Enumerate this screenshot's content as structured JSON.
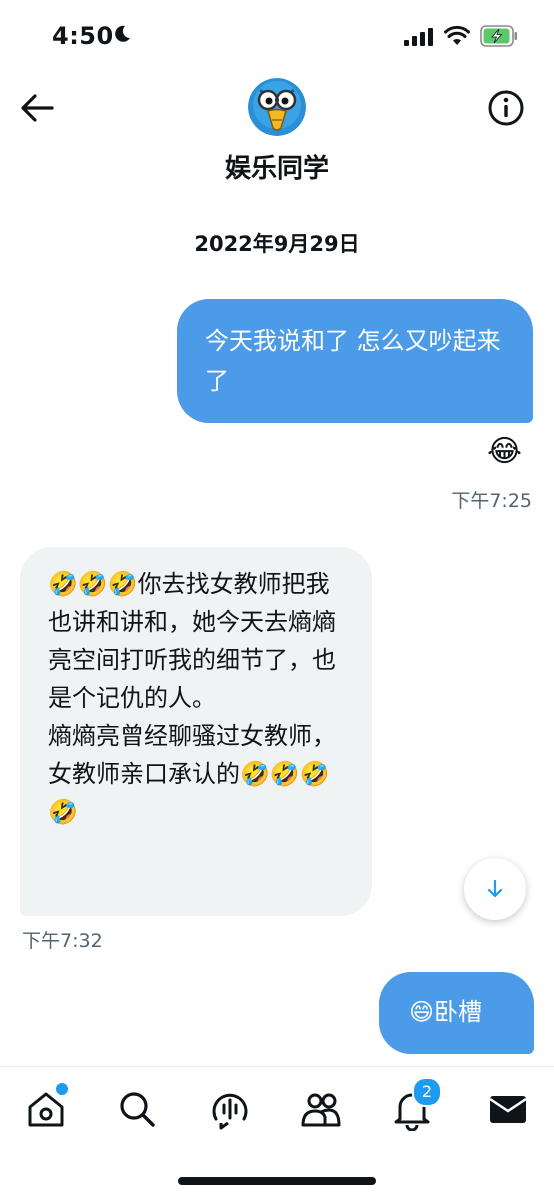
{
  "status": {
    "time": "4:50"
  },
  "header": {
    "title": "娱乐同学"
  },
  "conversation": {
    "date": "2022年9月29日",
    "messages": [
      {
        "direction": "out",
        "text": "今天我说和了 怎么又吵起来了",
        "reaction": "😂",
        "time": "下午7:25"
      },
      {
        "direction": "in",
        "text": "🤣🤣🤣你去找女教师把我也讲和讲和，她今天去熵熵亮空间打听我的细节了，也是个记仇的人。\n熵熵亮曾经聊骚过女教师，女教师亲口承认的🤣🤣🤣🤣",
        "time": "下午7:32"
      },
      {
        "direction": "out",
        "text": "😄卧槽"
      }
    ]
  },
  "tabbar": {
    "tabs": [
      {
        "icon": "home-icon",
        "has_dot": true
      },
      {
        "icon": "search-icon"
      },
      {
        "icon": "spaces-icon"
      },
      {
        "icon": "communities-icon"
      },
      {
        "icon": "bell-icon",
        "badge": "2"
      },
      {
        "icon": "mail-icon",
        "active": true
      }
    ]
  },
  "colors": {
    "accent": "#1d9bf0",
    "bubble_out": "#4c9be8",
    "bubble_in": "#eff3f4",
    "muted_text": "#536471"
  }
}
